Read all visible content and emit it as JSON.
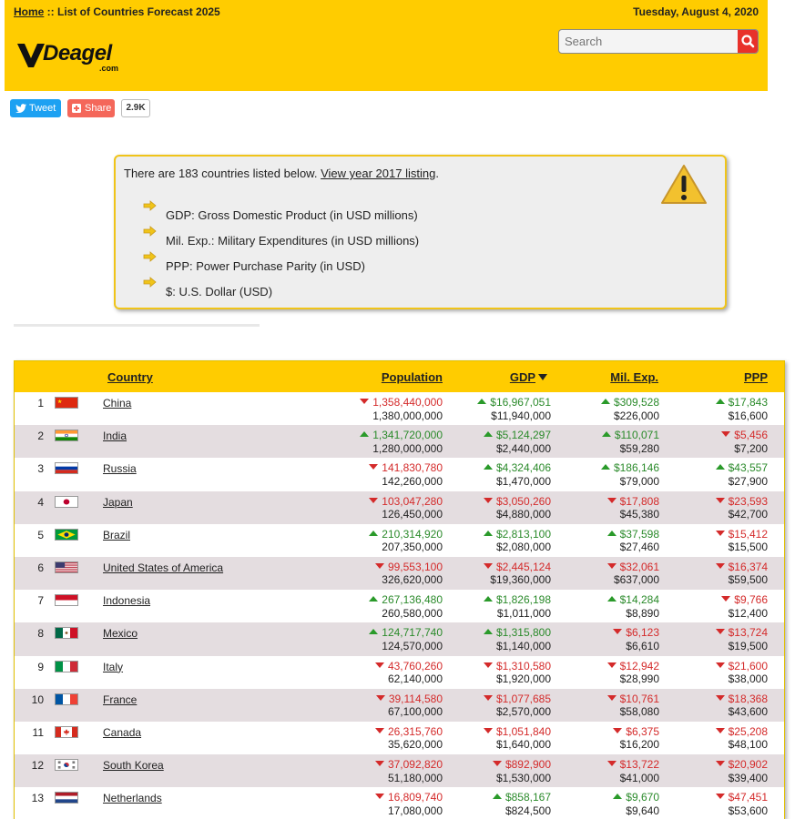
{
  "header": {
    "home_link": "Home",
    "crumb_sep": " :: ",
    "crumb_page": "List of Countries Forecast 2025",
    "date": "Tuesday, August 4, 2020",
    "logo_text": "Deagel",
    "logo_sub": ".com",
    "search_placeholder": "Search",
    "bg_color": "#ffcc00"
  },
  "social": {
    "tweet_label": "Tweet",
    "share_label": "Share",
    "share_count": "2.9K"
  },
  "notice": {
    "intro": "There are 183 countries listed below. ",
    "link": "View year 2017 listing",
    "intro_end": ".",
    "items": [
      "GDP: Gross Domestic Product (in USD millions)",
      "Mil. Exp.: Military Expenditures (in USD millions)",
      "PPP: Power Purchase Parity (in USD)",
      "$: U.S. Dollar (USD)"
    ]
  },
  "table": {
    "headers": {
      "country": "Country",
      "population": "Population",
      "gdp": "GDP",
      "mil": "Mil. Exp.",
      "ppp": "PPP"
    },
    "colors": {
      "up": "#2a8a2a",
      "down": "#d42a2a",
      "even_row": "#e4dde0"
    },
    "rows": [
      {
        "rank": "1",
        "flag": "cn",
        "country": "China",
        "pop_fc": "1,358,440,000",
        "pop_dir": "down",
        "pop": "1,380,000,000",
        "gdp_fc": "$16,967,051",
        "gdp_dir": "up",
        "gdp": "$11,940,000",
        "mil_fc": "$309,528",
        "mil_dir": "up",
        "mil": "$226,000",
        "ppp_fc": "$17,843",
        "ppp_dir": "up",
        "ppp": "$16,600"
      },
      {
        "rank": "2",
        "flag": "in",
        "country": "India",
        "pop_fc": "1,341,720,000",
        "pop_dir": "up",
        "pop": "1,280,000,000",
        "gdp_fc": "$5,124,297",
        "gdp_dir": "up",
        "gdp": "$2,440,000",
        "mil_fc": "$110,071",
        "mil_dir": "up",
        "mil": "$59,280",
        "ppp_fc": "$5,456",
        "ppp_dir": "down",
        "ppp": "$7,200"
      },
      {
        "rank": "3",
        "flag": "ru",
        "country": "Russia",
        "pop_fc": "141,830,780",
        "pop_dir": "down",
        "pop": "142,260,000",
        "gdp_fc": "$4,324,406",
        "gdp_dir": "up",
        "gdp": "$1,470,000",
        "mil_fc": "$186,146",
        "mil_dir": "up",
        "mil": "$79,000",
        "ppp_fc": "$43,557",
        "ppp_dir": "up",
        "ppp": "$27,900"
      },
      {
        "rank": "4",
        "flag": "jp",
        "country": "Japan",
        "pop_fc": "103,047,280",
        "pop_dir": "down",
        "pop": "126,450,000",
        "gdp_fc": "$3,050,260",
        "gdp_dir": "down",
        "gdp": "$4,880,000",
        "mil_fc": "$17,808",
        "mil_dir": "down",
        "mil": "$45,380",
        "ppp_fc": "$23,593",
        "ppp_dir": "down",
        "ppp": "$42,700"
      },
      {
        "rank": "5",
        "flag": "br",
        "country": "Brazil",
        "pop_fc": "210,314,920",
        "pop_dir": "up",
        "pop": "207,350,000",
        "gdp_fc": "$2,813,100",
        "gdp_dir": "up",
        "gdp": "$2,080,000",
        "mil_fc": "$37,598",
        "mil_dir": "up",
        "mil": "$27,460",
        "ppp_fc": "$15,412",
        "ppp_dir": "down",
        "ppp": "$15,500"
      },
      {
        "rank": "6",
        "flag": "us",
        "country": "United States of America",
        "pop_fc": "99,553,100",
        "pop_dir": "down",
        "pop": "326,620,000",
        "gdp_fc": "$2,445,124",
        "gdp_dir": "down",
        "gdp": "$19,360,000",
        "mil_fc": "$32,061",
        "mil_dir": "down",
        "mil": "$637,000",
        "ppp_fc": "$16,374",
        "ppp_dir": "down",
        "ppp": "$59,500"
      },
      {
        "rank": "7",
        "flag": "id",
        "country": "Indonesia",
        "pop_fc": "267,136,480",
        "pop_dir": "up",
        "pop": "260,580,000",
        "gdp_fc": "$1,826,198",
        "gdp_dir": "up",
        "gdp": "$1,011,000",
        "mil_fc": "$14,284",
        "mil_dir": "up",
        "mil": "$8,890",
        "ppp_fc": "$9,766",
        "ppp_dir": "down",
        "ppp": "$12,400"
      },
      {
        "rank": "8",
        "flag": "mx",
        "country": "Mexico",
        "pop_fc": "124,717,740",
        "pop_dir": "up",
        "pop": "124,570,000",
        "gdp_fc": "$1,315,800",
        "gdp_dir": "up",
        "gdp": "$1,140,000",
        "mil_fc": "$6,123",
        "mil_dir": "down",
        "mil": "$6,610",
        "ppp_fc": "$13,724",
        "ppp_dir": "down",
        "ppp": "$19,500"
      },
      {
        "rank": "9",
        "flag": "it",
        "country": "Italy",
        "pop_fc": "43,760,260",
        "pop_dir": "down",
        "pop": "62,140,000",
        "gdp_fc": "$1,310,580",
        "gdp_dir": "down",
        "gdp": "$1,920,000",
        "mil_fc": "$12,942",
        "mil_dir": "down",
        "mil": "$28,990",
        "ppp_fc": "$21,600",
        "ppp_dir": "down",
        "ppp": "$38,000"
      },
      {
        "rank": "10",
        "flag": "fr",
        "country": "France",
        "pop_fc": "39,114,580",
        "pop_dir": "down",
        "pop": "67,100,000",
        "gdp_fc": "$1,077,685",
        "gdp_dir": "down",
        "gdp": "$2,570,000",
        "mil_fc": "$10,761",
        "mil_dir": "down",
        "mil": "$58,080",
        "ppp_fc": "$18,368",
        "ppp_dir": "down",
        "ppp": "$43,600"
      },
      {
        "rank": "11",
        "flag": "ca",
        "country": "Canada",
        "pop_fc": "26,315,760",
        "pop_dir": "down",
        "pop": "35,620,000",
        "gdp_fc": "$1,051,840",
        "gdp_dir": "down",
        "gdp": "$1,640,000",
        "mil_fc": "$6,375",
        "mil_dir": "down",
        "mil": "$16,200",
        "ppp_fc": "$25,208",
        "ppp_dir": "down",
        "ppp": "$48,100"
      },
      {
        "rank": "12",
        "flag": "kr",
        "country": "South Korea",
        "pop_fc": "37,092,820",
        "pop_dir": "down",
        "pop": "51,180,000",
        "gdp_fc": "$892,900",
        "gdp_dir": "down",
        "gdp": "$1,530,000",
        "mil_fc": "$13,722",
        "mil_dir": "down",
        "mil": "$41,000",
        "ppp_fc": "$20,902",
        "ppp_dir": "down",
        "ppp": "$39,400"
      },
      {
        "rank": "13",
        "flag": "nl",
        "country": "Netherlands",
        "pop_fc": "16,809,740",
        "pop_dir": "down",
        "pop": "17,080,000",
        "gdp_fc": "$858,167",
        "gdp_dir": "up",
        "gdp": "$824,500",
        "mil_fc": "$9,670",
        "mil_dir": "up",
        "mil": "$9,640",
        "ppp_fc": "$47,451",
        "ppp_dir": "down",
        "ppp": "$53,600"
      }
    ]
  }
}
